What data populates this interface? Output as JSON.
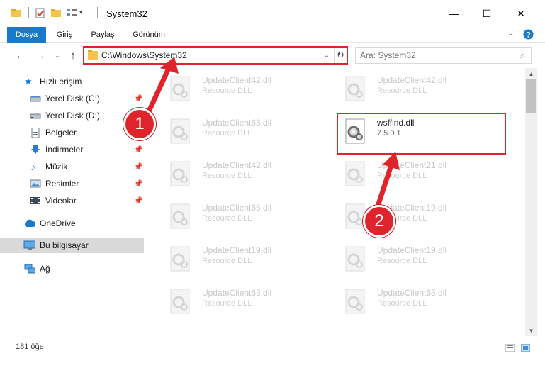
{
  "window": {
    "title": "System32",
    "minimize_glyph": "—",
    "maximize_glyph": "☐",
    "close_glyph": "✕"
  },
  "ribbon": {
    "tabs": [
      {
        "label": "Dosya",
        "active": true
      },
      {
        "label": "Giriş",
        "active": false
      },
      {
        "label": "Paylaş",
        "active": false
      },
      {
        "label": "Görünüm",
        "active": false
      }
    ]
  },
  "nav": {
    "address": "C:\\Windows\\System32",
    "search_placeholder": "Ara: System32"
  },
  "sidebar": {
    "items": [
      {
        "label": "Hızlı erişim",
        "icon": "star-icon",
        "pinned": false
      },
      {
        "label": "Yerel Disk (C:)",
        "icon": "drive-icon",
        "pinned": true
      },
      {
        "label": "Yerel Disk (D:)",
        "icon": "drive-icon",
        "pinned": true
      },
      {
        "label": "Belgeler",
        "icon": "documents-icon",
        "pinned": true
      },
      {
        "label": "İndirmeler",
        "icon": "download-icon",
        "pinned": true
      },
      {
        "label": "Müzik",
        "icon": "music-icon",
        "pinned": true
      },
      {
        "label": "Resimler",
        "icon": "pictures-icon",
        "pinned": true
      },
      {
        "label": "Videolar",
        "icon": "video-icon",
        "pinned": true
      },
      {
        "label": "OneDrive",
        "icon": "cloud-icon",
        "pinned": false
      },
      {
        "label": "Bu bilgisayar",
        "icon": "computer-icon",
        "pinned": false,
        "selected": true
      },
      {
        "label": "Ağ",
        "icon": "network-icon",
        "pinned": false
      }
    ]
  },
  "files": {
    "left_column": [
      {
        "name": "UpdateClient42.dll",
        "type": "Resource DLL"
      },
      {
        "name": "UpdateClient63.dll",
        "type": "Resource DLL"
      },
      {
        "name": "UpdateClient42.dll",
        "type": "Resource DLL"
      },
      {
        "name": "UpdateClient65.dll",
        "type": "Resource DLL"
      },
      {
        "name": "UpdateClient19.dll",
        "type": "Resource DLL"
      },
      {
        "name": "UpdateClient63.dll",
        "type": "Resource DLL"
      }
    ],
    "right_column": [
      {
        "name": "UpdateClient42.dll",
        "type": "Resource DLL"
      },
      {
        "name": "wsffind.dll",
        "type": "7.5.0.1",
        "highlighted": true
      },
      {
        "name": "UpdateClient21.dll",
        "type": "Resource DLL"
      },
      {
        "name": "UpdateClient19.dll",
        "type": "Resource DLL"
      },
      {
        "name": "UpdateClient19.dll",
        "type": "Resource DLL"
      },
      {
        "name": "UpdateClient65.dll",
        "type": "Resource DLL"
      }
    ]
  },
  "status": {
    "item_count": "181 öğe"
  },
  "callouts": [
    {
      "label": "1"
    },
    {
      "label": "2"
    }
  ],
  "colors": {
    "accent": "#1979ca",
    "highlight_red": "#e0242b",
    "selected_bg": "#d9d9d9"
  }
}
